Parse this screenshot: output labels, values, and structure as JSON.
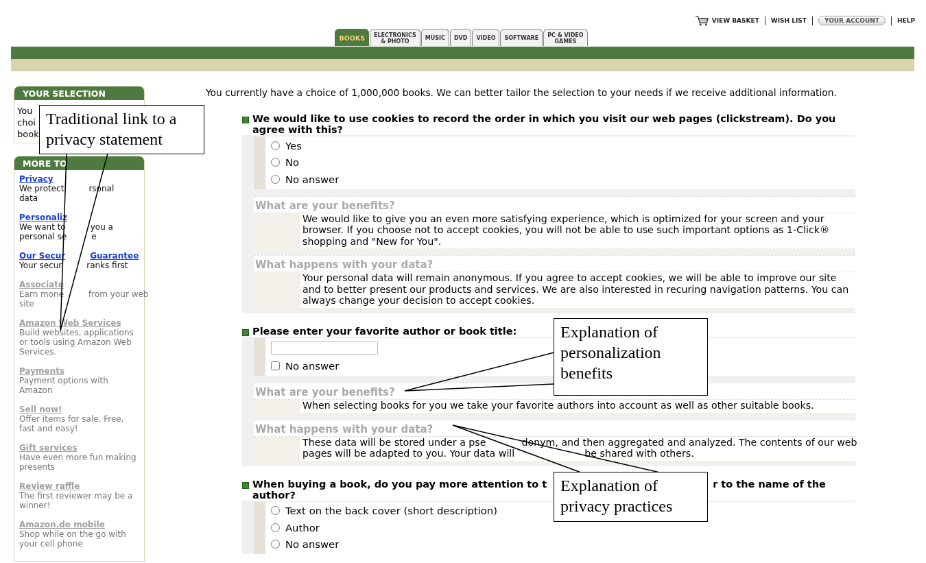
{
  "top_links": [
    {
      "kind": "basket",
      "label": "VIEW BASKET"
    },
    {
      "kind": "link",
      "label": "WISH LIST"
    },
    {
      "kind": "pill",
      "label": "YOUR ACCOUNT"
    },
    {
      "kind": "link",
      "label": "HELP"
    }
  ],
  "tabs": [
    {
      "lines": [
        "BOOKS"
      ],
      "selected": true
    },
    {
      "lines": [
        "ELECTRONICS",
        "& PHOTO"
      ],
      "selected": false
    },
    {
      "lines": [
        "MUSIC"
      ],
      "selected": false
    },
    {
      "lines": [
        "DVD"
      ],
      "selected": false
    },
    {
      "lines": [
        "VIDEO"
      ],
      "selected": false
    },
    {
      "lines": [
        "SOFTWARE"
      ],
      "selected": false
    },
    {
      "lines": [
        "PC & VIDEO",
        "GAMES"
      ],
      "selected": false
    }
  ],
  "sidebar": {
    "selection": {
      "title": "YOUR SELECTION",
      "lines": [
        "You",
        "choi",
        "book"
      ]
    },
    "more": {
      "title": "MORE TO",
      "items": [
        {
          "title": [
            "Privacy"
          ],
          "disabled": false,
          "desc": [
            [
              "We protect",
              "rsonal"
            ],
            [
              "data"
            ]
          ]
        },
        {
          "title": [
            "Personaliz"
          ],
          "disabled": false,
          "desc": [
            [
              "We want to",
              "you a"
            ],
            [
              "personal se",
              "e"
            ]
          ]
        },
        {
          "title": [
            "Our Secur",
            "Guarantee"
          ],
          "disabled": false,
          "desc": [
            [
              "Your secur",
              "ranks first"
            ]
          ]
        },
        {
          "title": [
            "Associate"
          ],
          "disabled": true,
          "desc": [
            [
              "Earn mone",
              "from your web"
            ],
            [
              "site"
            ]
          ]
        },
        {
          "title": [
            "Amazon Web Services"
          ],
          "disabled": true,
          "desc": [
            [
              "Build websites, applications"
            ],
            [
              "or tools using Amazon Web"
            ],
            [
              "Services."
            ]
          ]
        },
        {
          "title": [
            "Payments"
          ],
          "disabled": true,
          "desc": [
            [
              "Payment options with"
            ],
            [
              "Amazon"
            ]
          ]
        },
        {
          "title": [
            "Sell now!"
          ],
          "disabled": true,
          "desc": [
            [
              "Offer items for sale. Free,"
            ],
            [
              "fast and easy!"
            ]
          ]
        },
        {
          "title": [
            "Gift services"
          ],
          "disabled": true,
          "desc": [
            [
              "Have even more fun making"
            ],
            [
              "presents"
            ]
          ]
        },
        {
          "title": [
            "Review raffle"
          ],
          "disabled": true,
          "desc": [
            [
              "The first reviewer may be a"
            ],
            [
              "winner!"
            ]
          ]
        },
        {
          "title": [
            "Amazon.de mobile"
          ],
          "disabled": true,
          "desc": [
            [
              "Shop while on the go with"
            ],
            [
              "your cell phone"
            ]
          ]
        }
      ]
    }
  },
  "intro": "You currently have a choice of 1,000,000 books. We can better tailor the selection to your needs if we receive additional information.",
  "questions": [
    {
      "title": [
        [
          "We would like to use cookies to record the order in which you visit our web pages (clickstream). Do you agree with this?"
        ]
      ],
      "answers": [
        {
          "kind": "radio",
          "label": "Yes",
          "checked": false
        },
        {
          "kind": "radio",
          "label": "No",
          "checked": false
        },
        {
          "kind": "radio",
          "label": "No answer",
          "checked": false
        }
      ],
      "explanations": [
        {
          "heading": "What are your benefits?",
          "text": "We would like to give you an even more satisfying experience, which is optimized for your screen and your browser. If you choose not to accept cookies, you will not be able to use such important options as 1-Click® shopping and \"New for You\"."
        },
        {
          "heading": "What happens with your data?",
          "text": "Your personal data will remain anonymous. If you agree to accept cookies, we will be able to improve our site and to better present our products and services. We are also interested in recuring navigation patterns. You can always change your decision to accept cookies."
        }
      ]
    },
    {
      "title": [
        [
          "Please enter your favorite author or book title:"
        ]
      ],
      "answers": [
        {
          "kind": "text"
        },
        {
          "kind": "checkbox",
          "label": "No answer",
          "checked": false
        }
      ],
      "explanations": [
        {
          "heading": "What are your benefits?",
          "text": "When selecting books for you we take your favorite authors into account as well as other suitable books."
        },
        {
          "heading": "What happens with your data?",
          "lines": [
            [
              "These data will be stored under a pse",
              "donym, and then aggregated and analyzed. The contents of our web"
            ],
            [
              "pages will be adapted to you. Your data will",
              "be shared with others."
            ]
          ]
        }
      ]
    },
    {
      "title": [
        [
          "When buying a book, do you pay more attention to t",
          "r to the name of the"
        ],
        [
          "author?"
        ]
      ],
      "answers": [
        {
          "kind": "radio",
          "label": "Text on the back cover (short description)",
          "checked": false
        },
        {
          "kind": "radio",
          "label": "Author",
          "checked": false
        },
        {
          "kind": "radio",
          "label": "No answer",
          "checked": false
        }
      ]
    }
  ],
  "callouts": [
    {
      "text": "Traditional link to a privacy statement"
    },
    {
      "text": "Explanation of personalization benefits"
    },
    {
      "text": "Explanation of privacy practices"
    }
  ]
}
